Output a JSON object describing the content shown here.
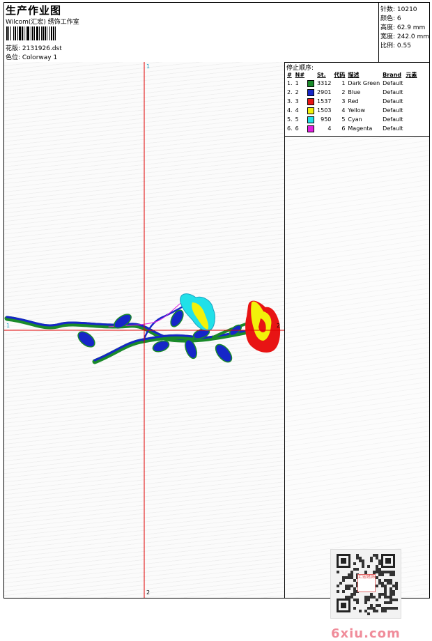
{
  "header": {
    "title": "生产作业图",
    "company": "Wilcom(汇宏) 绣饰工作室",
    "design_label": "花版: 2131926.dst",
    "colorway_label": "色位: Colorway 1"
  },
  "stats": [
    {
      "label": "针数: 10210"
    },
    {
      "label": "颜色: 6"
    },
    {
      "label": "高度: 62.9 mm"
    },
    {
      "label": "宽度: 242.0 mm"
    },
    {
      "label": "比例: 0.55"
    }
  ],
  "stop_sequence": {
    "title": "停止顺序:",
    "headers": [
      "#",
      "N#",
      "St.",
      "代码",
      "描述",
      "Brand",
      "元素"
    ],
    "rows": [
      {
        "idx": "1.",
        "n": "1",
        "color": "#1a8a2a",
        "st": "3312",
        "code": "1",
        "desc": "Dark Green",
        "brand": "Default"
      },
      {
        "idx": "2.",
        "n": "2",
        "color": "#1626c8",
        "st": "2901",
        "code": "2",
        "desc": "Blue",
        "brand": "Default"
      },
      {
        "idx": "3.",
        "n": "3",
        "color": "#e81414",
        "st": "1537",
        "code": "3",
        "desc": "Red",
        "brand": "Default"
      },
      {
        "idx": "4.",
        "n": "4",
        "color": "#f2f20a",
        "st": "1503",
        "code": "4",
        "desc": "Yellow",
        "brand": "Default"
      },
      {
        "idx": "5.",
        "n": "5",
        "color": "#20e0e8",
        "st": "950",
        "code": "5",
        "desc": "Cyan",
        "brand": "Default"
      },
      {
        "idx": "6.",
        "n": "6",
        "color": "#e020e0",
        "st": "4",
        "code": "6",
        "desc": "Magenta",
        "brand": "Default"
      }
    ]
  },
  "axes": {
    "v_top": "1",
    "v_bottom": "2",
    "h_left": "1",
    "h_right": "2",
    "line_color": "#e00000"
  },
  "watermark": {
    "text": "6xiu.com",
    "stamp": "汇宏绣饰"
  }
}
